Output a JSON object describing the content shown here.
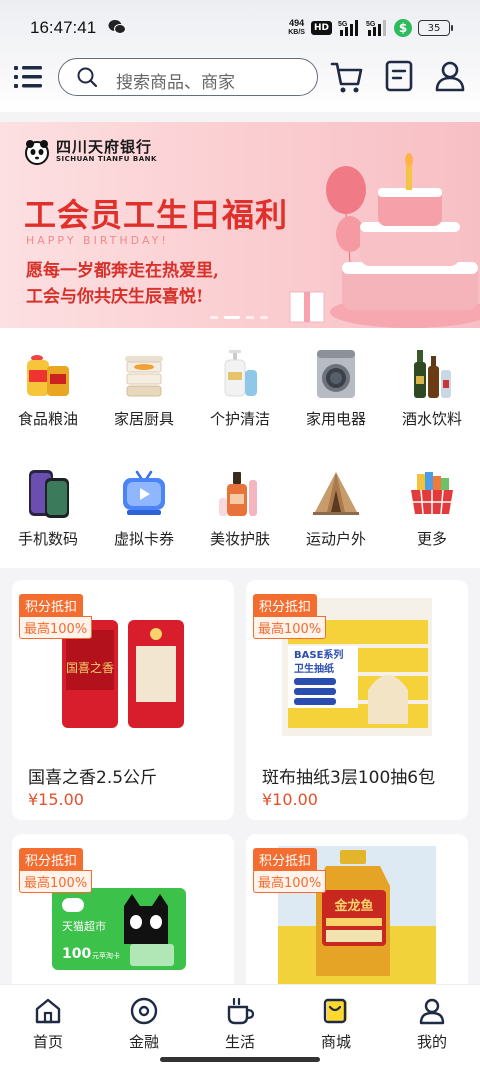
{
  "statusbar": {
    "time": "16:47:41",
    "net_speed_value": "494",
    "net_speed_unit": "KB/S",
    "hd": "HD",
    "signal1_label": "5G",
    "signal2_label": "5G",
    "money_icon": "$",
    "battery": "35"
  },
  "search": {
    "placeholder": "搜索商品、商家"
  },
  "banner": {
    "bank_name": "四川天府银行",
    "bank_name_en": "SICHUAN TIANFU BANK",
    "title": "工会员工生日福利",
    "subtitle_en": "HAPPY BIRTHDAY!",
    "line1": "愿每一岁都奔走在热爱里,",
    "line2": "工会与你共庆生辰喜悦!"
  },
  "categories": [
    {
      "label": "食品粮油",
      "icon": "grain-oil-icon"
    },
    {
      "label": "家居厨具",
      "icon": "kitchen-icon"
    },
    {
      "label": "个护清洁",
      "icon": "personal-care-icon"
    },
    {
      "label": "家用电器",
      "icon": "appliance-icon"
    },
    {
      "label": "酒水饮料",
      "icon": "drinks-icon"
    },
    {
      "label": "手机数码",
      "icon": "phone-icon"
    },
    {
      "label": "虚拟卡券",
      "icon": "virtual-card-icon"
    },
    {
      "label": "美妆护肤",
      "icon": "cosmetics-icon"
    },
    {
      "label": "运动户外",
      "icon": "outdoor-tent-icon"
    },
    {
      "label": "更多",
      "icon": "more-icon"
    }
  ],
  "products": [
    {
      "tag1": "积分抵扣",
      "tag2": "最高100%",
      "name": "国喜之香2.5公斤",
      "price": "¥15.00"
    },
    {
      "tag1": "积分抵扣",
      "tag2": "最高100%",
      "name": "斑布抽纸3层100抽6包",
      "price": "¥10.00"
    },
    {
      "tag1": "积分抵扣",
      "tag2": "最高100%",
      "name": "",
      "price": ""
    },
    {
      "tag1": "积分抵扣",
      "tag2": "最高100%",
      "name": "",
      "price": ""
    }
  ],
  "product_image_text": {
    "rice_brand": "国喜之香",
    "tissue_series": "BASE系列",
    "tissue_type": "卫生抽纸",
    "card_store": "天猫超市",
    "card_amount": "100",
    "card_amount_note": "元苹淘卡",
    "oil_brand": "金龙鱼"
  },
  "bottom_nav": [
    {
      "label": "首页",
      "icon": "home-icon"
    },
    {
      "label": "金融",
      "icon": "finance-icon"
    },
    {
      "label": "生活",
      "icon": "life-cup-icon"
    },
    {
      "label": "商城",
      "icon": "mall-bag-icon"
    },
    {
      "label": "我的",
      "icon": "profile-icon"
    }
  ],
  "colors": {
    "accent": "#f26d2f",
    "price": "#e5502b",
    "banner_title": "#e0302b",
    "mall_active": "#ffd92e"
  }
}
